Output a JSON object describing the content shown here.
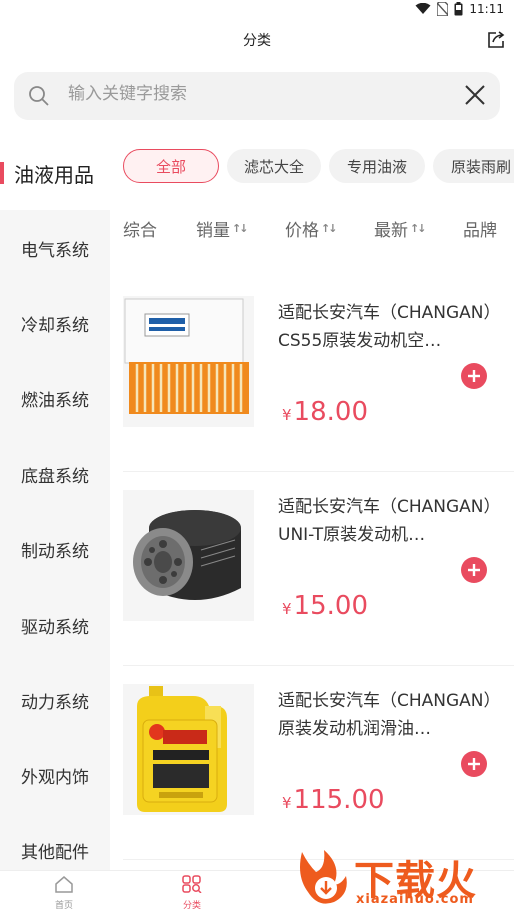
{
  "status": {
    "time": "11:11"
  },
  "header": {
    "title": "分类"
  },
  "search": {
    "placeholder": "输入关键字搜索"
  },
  "sidebar": {
    "active": "油液用品",
    "items": [
      "电气系统",
      "冷却系统",
      "燃油系统",
      "底盘系统",
      "制动系统",
      "驱动系统",
      "动力系统",
      "外观内饰",
      "其他配件"
    ]
  },
  "chips": [
    "全部",
    "滤芯大全",
    "专用油液",
    "原装雨刷"
  ],
  "sort": {
    "comprehensive": "综合",
    "sales": "销量",
    "price": "价格",
    "newest": "最新",
    "brand": "品牌"
  },
  "products": [
    {
      "title": "适配长安汽车（CHANGAN）CS55原装发动机空…",
      "currency": "¥",
      "price": "18.00"
    },
    {
      "title": "适配长安汽车（CHANGAN）UNI-T原装发动机…",
      "currency": "¥",
      "price": "15.00"
    },
    {
      "title": "适配长安汽车（CHANGAN）原装发动机润滑油…",
      "currency": "¥",
      "price": "115.00"
    }
  ],
  "nav": {
    "home": "首页",
    "category": "分类"
  },
  "watermark": {
    "text": "下载火",
    "url": "xiazaihuo.com"
  },
  "colors": {
    "accent": "#e94b5f",
    "watermark": "#ee5b1e"
  }
}
